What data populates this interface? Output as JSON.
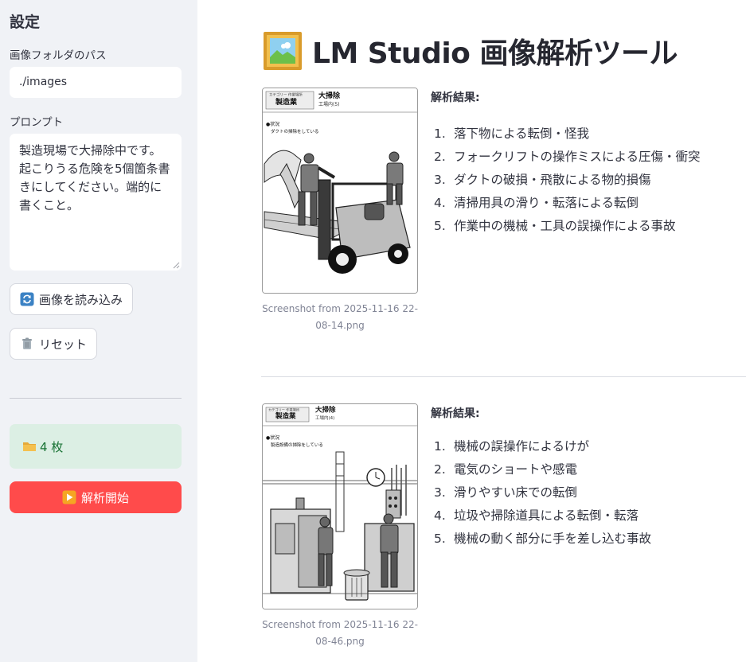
{
  "sidebar": {
    "title": "設定",
    "folder_label": "画像フォルダのパス",
    "folder_value": "./images",
    "prompt_label": "プロンプト",
    "prompt_value": "製造現場で大掃除中です。起こりうる危険を5個箇条書きにしてください。端的に書くこと。",
    "load_button": "画像を読み込み",
    "load_icon": "refresh-icon",
    "reset_button": "リセット",
    "reset_icon": "trash-icon",
    "image_count": "4 枚",
    "count_icon": "folder-icon",
    "start_button": "解析開始",
    "start_icon": "play-icon"
  },
  "main": {
    "title": "LM Studio 画像解析ツール",
    "title_icon": "framed-picture-icon",
    "results": [
      {
        "caption": "Screenshot from 2025-11-16 22-08-14.png",
        "heading": "解析結果:",
        "image_text": {
          "category": "カテゴリー 作業場所",
          "industry": "製造業",
          "task": "大掃除",
          "sub": "工場内(5)",
          "situation_label": "●状況",
          "situation": "ダクトの掃除をしている"
        },
        "items": [
          "落下物による転倒・怪我",
          "フォークリフトの操作ミスによる圧傷・衝突",
          "ダクトの破損・飛散による物的損傷",
          "清掃用具の滑り・転落による転倒",
          "作業中の機械・工具の誤操作による事故"
        ]
      },
      {
        "caption": "Screenshot from 2025-11-16 22-08-46.png",
        "heading": "解析結果:",
        "image_text": {
          "category": "カテゴリー 作業場所",
          "industry": "製造業",
          "task": "大掃除",
          "sub": "工場内(4)",
          "situation_label": "●状況",
          "situation": "製造設備の掃除をしている"
        },
        "items": [
          "機械の誤操作によるけが",
          "電気のショートや感電",
          "滑りやすい床での転倒",
          "垃圾や掃除道具による転倒・転落",
          "機械の動く部分に手を差し込む事故"
        ]
      }
    ]
  },
  "colors": {
    "sidebar_bg": "#f0f2f6",
    "primary": "#ff4b4b",
    "success_bg": "#dcefe4",
    "success_text": "#177233"
  }
}
